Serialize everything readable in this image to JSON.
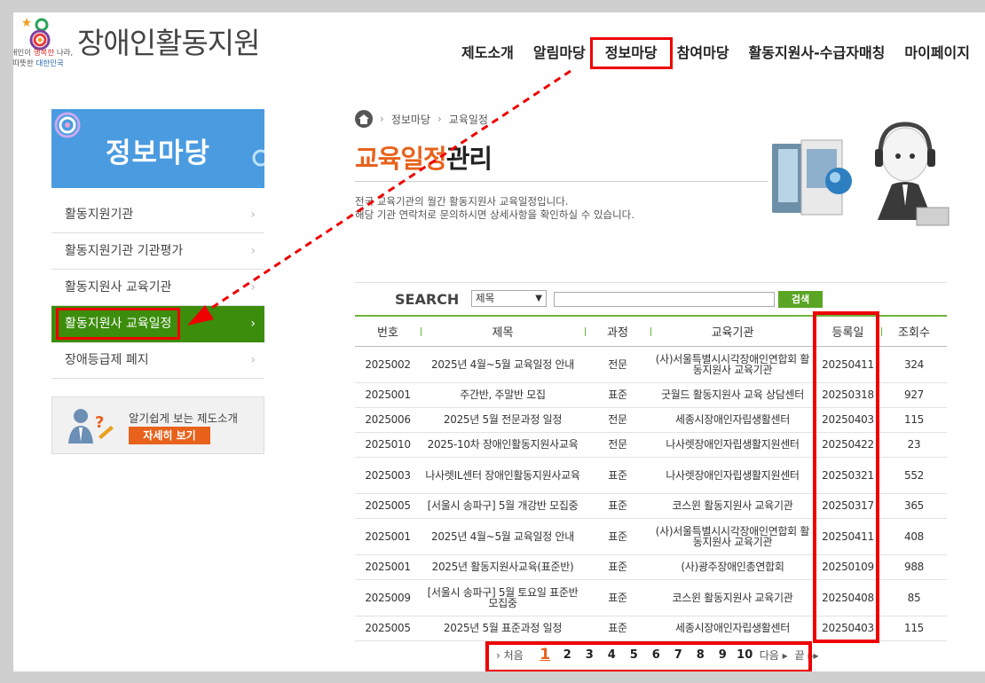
{
  "site": {
    "title": "장애인활동지원",
    "slogan_1": "장애인이",
    "slogan_2": "행복한",
    "slogan_3": "나라,",
    "slogan_4": "따뜻한",
    "slogan_5": "대한민국"
  },
  "gnb": [
    "제도소개",
    "알림마당",
    "정보마당",
    "참여마당",
    "활동지원사-수급자매칭",
    "마이페이지"
  ],
  "sidebar": {
    "banner_title": "정보마당",
    "items": [
      "활동지원기관",
      "활동지원기관 기관평가",
      "활동지원사 교육기관",
      "활동지원사 교육일정",
      "장애등급제 폐지"
    ],
    "arrow": "›",
    "intro_text": "알기쉽게 보는 제도소개",
    "intro_button": "자세히 보기"
  },
  "breadcrumb": [
    "정보마당",
    "교육일정"
  ],
  "breadcrumb_sep": "›",
  "title": {
    "highlight": "교육일정",
    "rest": "관리"
  },
  "description": [
    "전국 교육기관의 월간 활동지원사 교육일정입니다.",
    "해당 기관 연락처로 문의하시면 상세사항을 확인하실 수 있습니다."
  ],
  "search": {
    "label": "SEARCH",
    "select_value": "제목",
    "button": "검색"
  },
  "table": {
    "headers": [
      "번호",
      "제목",
      "과정",
      "교육기관",
      "등록일",
      "조회수"
    ],
    "rows": [
      [
        "2025002",
        "2025년 4월~5월 교육일정 안내",
        "전문",
        "(사)서울특별시시각장애인연합회 활동지원사 교육기관",
        "20250411",
        "324"
      ],
      [
        "2025001",
        "주간반, 주말반 모집",
        "표준",
        "굿월드 활동지원사 교육 상담센터",
        "20250318",
        "927"
      ],
      [
        "2025006",
        "2025년 5월 전문과정 일정",
        "전문",
        "세종시장애인자립생활센터",
        "20250403",
        "115"
      ],
      [
        "2025010",
        "2025-10차 장애인활동지원사교육",
        "전문",
        "나사렛장애인자립생활지원센터",
        "20250422",
        "23"
      ],
      [
        "2025003",
        "나사렛IL센터 장애인활동지원사교육",
        "표준",
        "나사렛장애인자립생활지원센터",
        "20250321",
        "552"
      ],
      [
        "2025005",
        "[서울시 송파구] 5월 개강반 모집중",
        "표준",
        "코스윈 활동지원사 교육기관",
        "20250317",
        "365"
      ],
      [
        "2025001",
        "2025년 4월~5월 교육일정 안내",
        "표준",
        "(사)서울특별시시각장애인연합회 활동지원사 교육기관",
        "20250411",
        "408"
      ],
      [
        "2025001",
        "2025년 활동지원사교육(표준반)",
        "표준",
        "(사)광주장애인총연합회",
        "20250109",
        "988"
      ],
      [
        "2025009",
        "[서울시 송파구] 5월 토요일 표준반 모집중",
        "표준",
        "코스윈 활동지원사 교육기관",
        "20250408",
        "85"
      ],
      [
        "2025005",
        "2025년 5월 표준과정 일정",
        "표준",
        "세종시장애인자립생활센터",
        "20250403",
        "115"
      ]
    ]
  },
  "pager": {
    "first": "처음",
    "pages": [
      "1",
      "2",
      "3",
      "4",
      "5",
      "6",
      "7",
      "8",
      "9",
      "10"
    ],
    "current": "1",
    "next": "다음",
    "last": "끝"
  },
  "colors": {
    "accent_orange": "#e8621c",
    "green": "#3c8d0c",
    "highlight_red": "#e00",
    "banner_blue": "#4a9be0"
  }
}
